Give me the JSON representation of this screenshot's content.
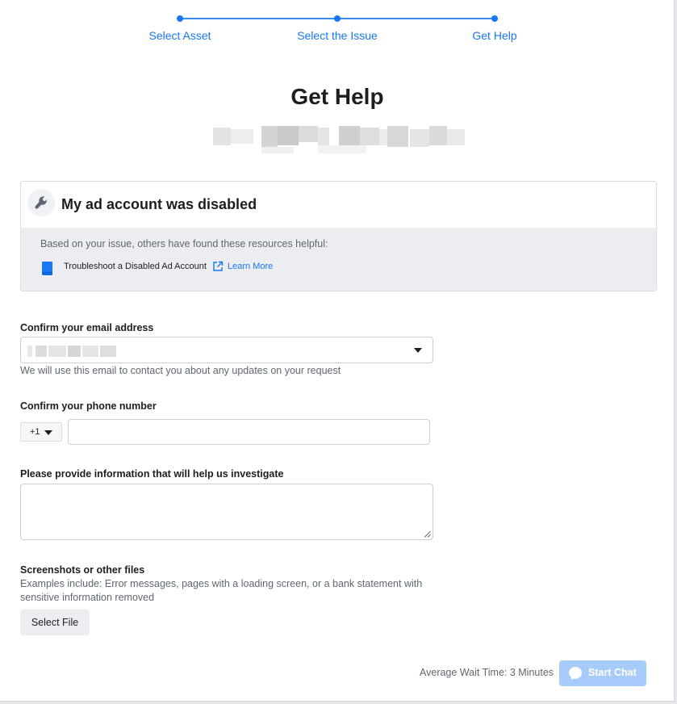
{
  "stepper": {
    "steps": [
      {
        "label": "Select Asset"
      },
      {
        "label": "Select the Issue"
      },
      {
        "label": "Get Help"
      }
    ]
  },
  "page": {
    "title": "Get Help"
  },
  "issue": {
    "title": "My ad account was disabled",
    "helpful_text": "Based on your issue, others have found these resources helpful:",
    "resource_title": "Troubleshoot a Disabled Ad Account",
    "learn_more": "Learn More"
  },
  "email": {
    "label": "Confirm your email address",
    "hint": "We will use this email to contact you about any updates on your request"
  },
  "phone": {
    "label": "Confirm your phone number",
    "country_code": "+1",
    "value": ""
  },
  "details": {
    "label": "Please provide information that will help us investigate",
    "value": ""
  },
  "files": {
    "label": "Screenshots or other files",
    "hint": "Examples include: Error messages, pages with a loading screen, or a bank statement with sensitive information removed",
    "button": "Select File"
  },
  "footer": {
    "wait_time": "Average Wait Time: 3 Minutes",
    "chat_button": "Start Chat"
  },
  "colors": {
    "accent": "#1877f2",
    "chat_button_disabled": "#a7ccfb"
  },
  "icons": [
    "wrench-icon",
    "book-icon",
    "external-link-icon",
    "chevron-down-icon",
    "chat-bubble-icon"
  ]
}
